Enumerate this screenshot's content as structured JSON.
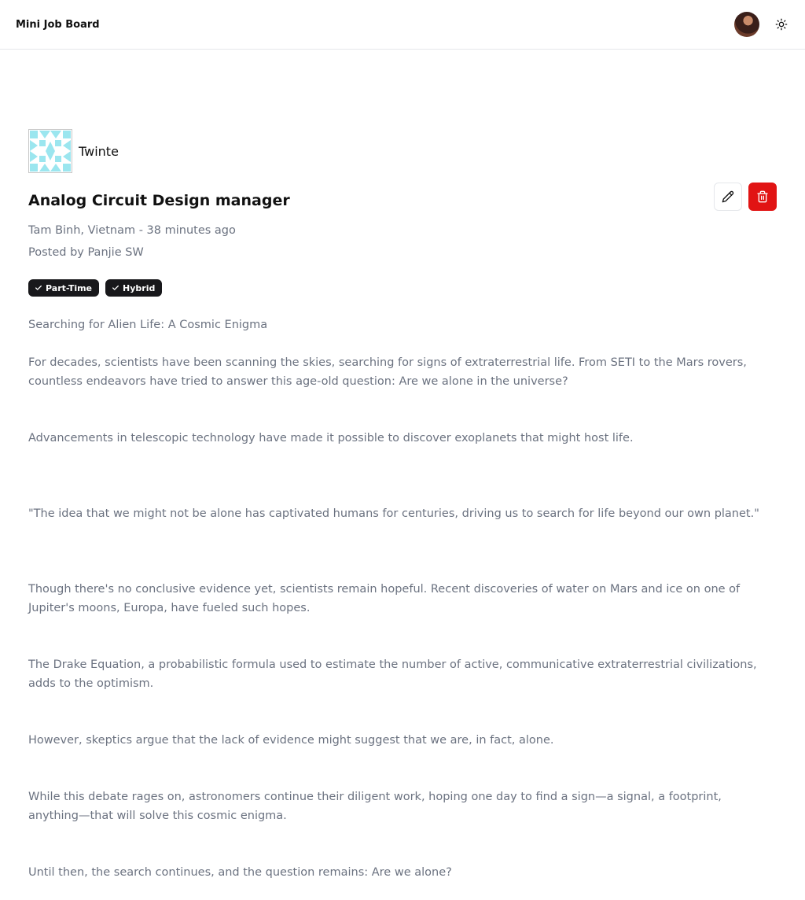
{
  "header": {
    "brand": "Mini Job Board"
  },
  "company": {
    "name": "Twinte"
  },
  "job": {
    "title": "Analog Circuit Design manager",
    "location_time": "Tam Binh, Vietnam - 38 minutes ago",
    "posted_by": "Posted by Panjie SW",
    "tags": [
      "Part-Time",
      "Hybrid"
    ]
  },
  "description": {
    "p0": "Searching for Alien Life: A Cosmic Enigma",
    "p1": "For decades, scientists have been scanning the skies, searching for signs of extraterrestrial life. From SETI to the Mars rovers, countless endeavors have tried to answer this age-old question: Are we alone in the universe?",
    "p2": "Advancements in telescopic technology have made it possible to discover exoplanets that might host life.",
    "p3": "\"The idea that we might not be alone has captivated humans for centuries, driving us to search for life beyond our own planet.\"",
    "p4": "Though there's no conclusive evidence yet, scientists remain hopeful. Recent discoveries of water on Mars and ice on one of Jupiter's moons, Europa, have fueled such hopes.",
    "p5": "The Drake Equation, a probabilistic formula used to estimate the number of active, communicative extraterrestrial civilizations, adds to the optimism.",
    "p6": "However, skeptics argue that the lack of evidence might suggest that we are, in fact, alone.",
    "p7": "While this debate rages on, astronomers continue their diligent work, hoping one day to find a sign—a signal, a footprint, anything—that will solve this cosmic enigma.",
    "p8": "Until then, the search continues, and the question remains: Are we alone?"
  },
  "icons": {
    "theme": "sun-icon",
    "edit": "pencil-icon",
    "delete": "trash-icon",
    "tag": "check-icon"
  },
  "colors": {
    "delete_button": "#e11414",
    "tag_background": "#18181b",
    "logo_tint": "#9be6ef"
  }
}
